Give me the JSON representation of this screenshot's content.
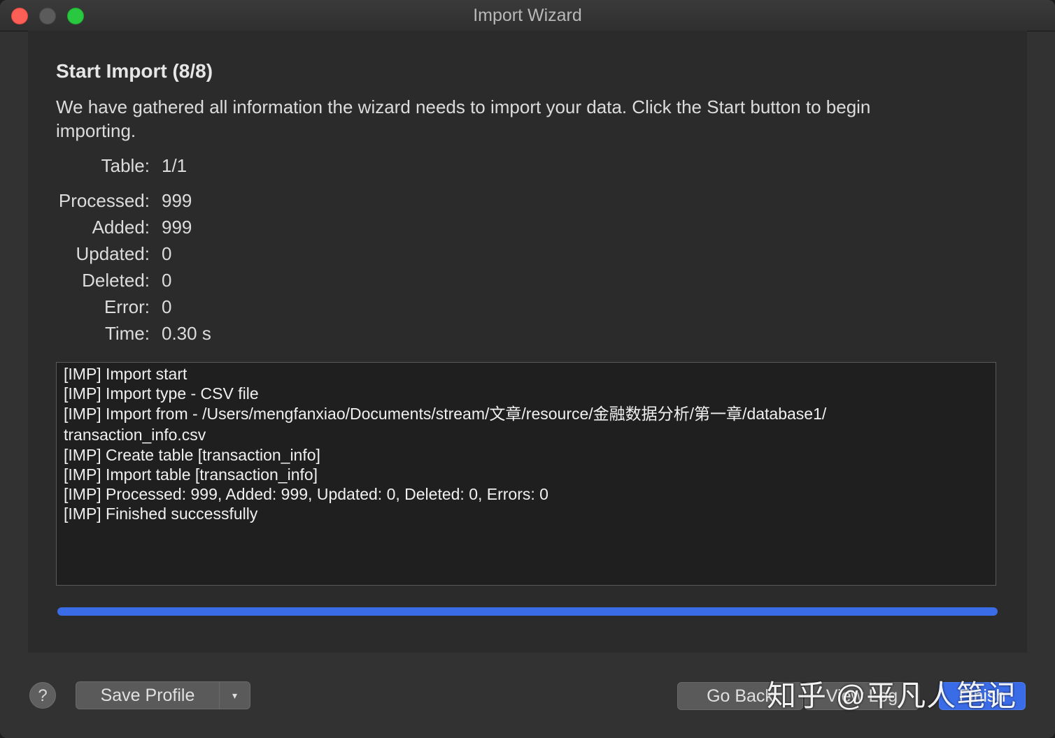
{
  "window": {
    "title": "Import Wizard"
  },
  "page": {
    "heading": "Start Import (8/8)",
    "description": "We have gathered all information the wizard needs to import your data. Click the Start button to begin importing."
  },
  "stats": {
    "table_label": "Table:",
    "table_value": "1/1",
    "processed_label": "Processed:",
    "processed_value": "999",
    "added_label": "Added:",
    "added_value": "999",
    "updated_label": "Updated:",
    "updated_value": "0",
    "deleted_label": "Deleted:",
    "deleted_value": "0",
    "error_label": "Error:",
    "error_value": "0",
    "time_label": "Time:",
    "time_value": "0.30 s"
  },
  "log": {
    "lines": [
      "[IMP] Import start",
      "[IMP] Import type - CSV file",
      "[IMP] Import from - /Users/mengfanxiao/Documents/stream/文章/resource/金融数据分析/第一章/database1/ transaction_info.csv",
      "[IMP] Create table [transaction_info]",
      "[IMP] Import table [transaction_info]",
      "[IMP] Processed: 999, Added: 999, Updated: 0, Deleted: 0, Errors: 0",
      "[IMP] Finished successfully"
    ]
  },
  "progress": {
    "fraction": 1.0,
    "color": "#3b6ce8"
  },
  "footer": {
    "help_label": "?",
    "save_profile_label": "Save Profile",
    "dropdown_arrow": "▾",
    "go_back_label": "Go Back",
    "view_log_label": "View Log",
    "finish_label": "Finish"
  },
  "watermark": "知乎 @平凡人笔记",
  "colors": {
    "accent": "#3b6ce8",
    "close": "#fd5f57",
    "maximize": "#2ac840"
  }
}
